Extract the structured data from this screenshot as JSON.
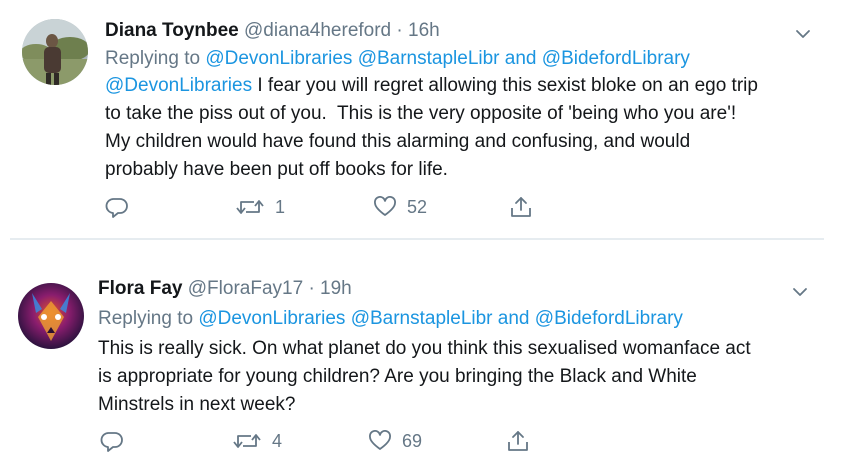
{
  "tweets": [
    {
      "name": "Diana Toynbee",
      "handle": "@diana4hereford",
      "separator": "·",
      "time": "16h",
      "replying_prefix": "Replying to",
      "reply_mention_1": "@DevonLibraries",
      "reply_mention_2": "@BarnstapleLibr",
      "reply_and": "and",
      "reply_mention_3": "@BidefordLibrary",
      "body_mention": "@DevonLibraries",
      "body_line_1": " I fear you will regret allowing this sexist bloke on an ego trip",
      "body_line_2": "to take the piss out of you.  This is the very opposite of 'being who you are'!",
      "body_line_3": "My children would have found this alarming and confusing, and would",
      "body_line_4": "probably have been put off books for life.",
      "replies_count": "",
      "retweets_count": "1",
      "likes_count": "52"
    },
    {
      "name": "Flora Fay",
      "handle": "@FloraFay17",
      "separator": "·",
      "time": "19h",
      "replying_prefix": "Replying to",
      "reply_mention_1": "@DevonLibraries",
      "reply_mention_2": "@BarnstapleLibr",
      "reply_and": "and",
      "reply_mention_3": "@BidefordLibrary",
      "body_line_1": "This is really sick. On what planet do you think this sexualised womanface act",
      "body_line_2": "is appropriate for young children? Are you bringing the Black and White",
      "body_line_3": "Minstrels in next week?",
      "replies_count": "",
      "retweets_count": "4",
      "likes_count": "69"
    }
  ],
  "icons": {
    "reply": "reply-icon",
    "retweet": "retweet-icon",
    "like": "heart-icon",
    "share": "share-icon",
    "more": "chevron-down-icon"
  },
  "colors": {
    "link": "#1b95e0",
    "secondary_text": "#657786",
    "primary_text": "#14171a",
    "divider": "#e6ecf0"
  }
}
